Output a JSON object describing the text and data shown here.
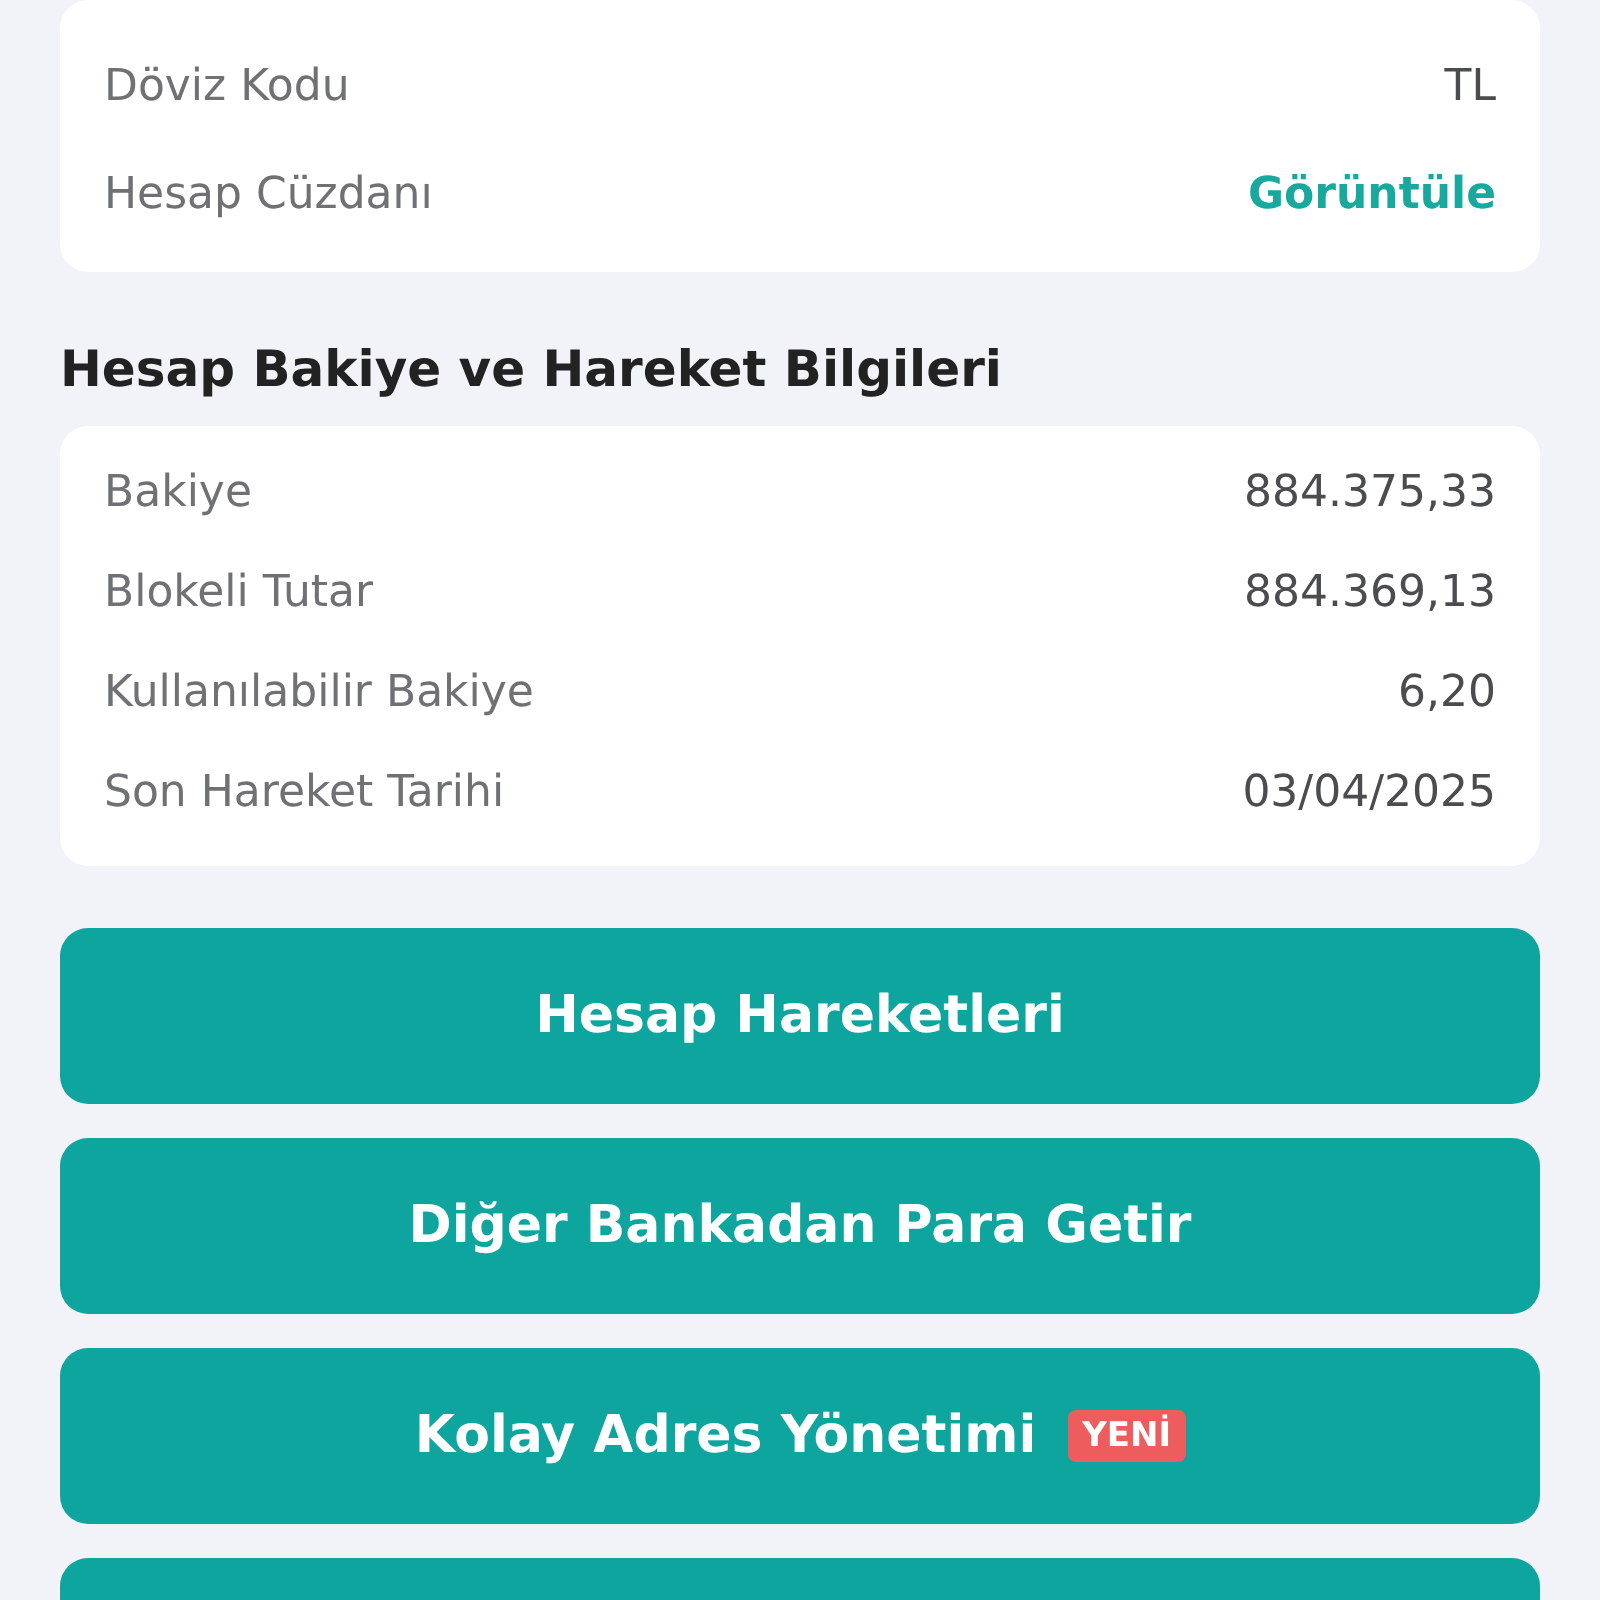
{
  "account_details": {
    "rows": [
      {
        "label": "Döviz Kodu",
        "value": "TL",
        "kind": "text"
      },
      {
        "label": "Hesap Cüzdanı",
        "value": "Görüntüle",
        "kind": "link"
      }
    ]
  },
  "balance_section": {
    "title": "Hesap Bakiye ve Hareket Bilgileri",
    "rows": [
      {
        "label": "Bakiye",
        "value": "884.375,33"
      },
      {
        "label": "Blokeli Tutar",
        "value": "884.369,13"
      },
      {
        "label": "Kullanılabilir Bakiye",
        "value": "6,20"
      },
      {
        "label": "Son Hareket Tarihi",
        "value": "03/04/2025"
      }
    ]
  },
  "actions": [
    {
      "kind": "button",
      "label": "Hesap Hareketleri"
    },
    {
      "kind": "button",
      "label": "Diğer Bankadan Para Getir"
    },
    {
      "kind": "button",
      "label": "Kolay Adres Yönetimi",
      "badge": "YENİ"
    },
    {
      "kind": "cut_off"
    }
  ]
}
